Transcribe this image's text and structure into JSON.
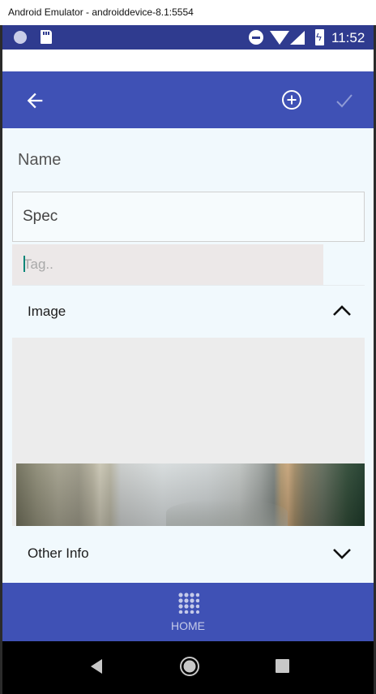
{
  "window": {
    "title": "Android Emulator - androiddevice-8.1:5554"
  },
  "status_bar": {
    "time": "11:52"
  },
  "toolbar": {
    "back_icon": "arrow-back-icon",
    "add_icon": "add-circle-icon",
    "confirm_icon": "checkmark-icon"
  },
  "form": {
    "name_label": "Name",
    "name_value": "Spec",
    "tag_placeholder": "Tag.."
  },
  "sections": {
    "image": {
      "title": "Image",
      "icon": "chevron-up-icon"
    },
    "other_info": {
      "title": "Other Info",
      "icon": "chevron-down-icon"
    }
  },
  "bottom_nav": {
    "home_label": "HOME",
    "home_icon": "apps-grid-icon"
  },
  "system_nav": {
    "back": "nav-back-icon",
    "home": "nav-home-icon",
    "recents": "nav-recents-icon"
  },
  "colors": {
    "primary": "#3f51b5",
    "status_bar": "#2f3b8f",
    "content_bg": "#f1f9fd",
    "tag_bg": "#ece8e8",
    "cursor": "#008577"
  }
}
